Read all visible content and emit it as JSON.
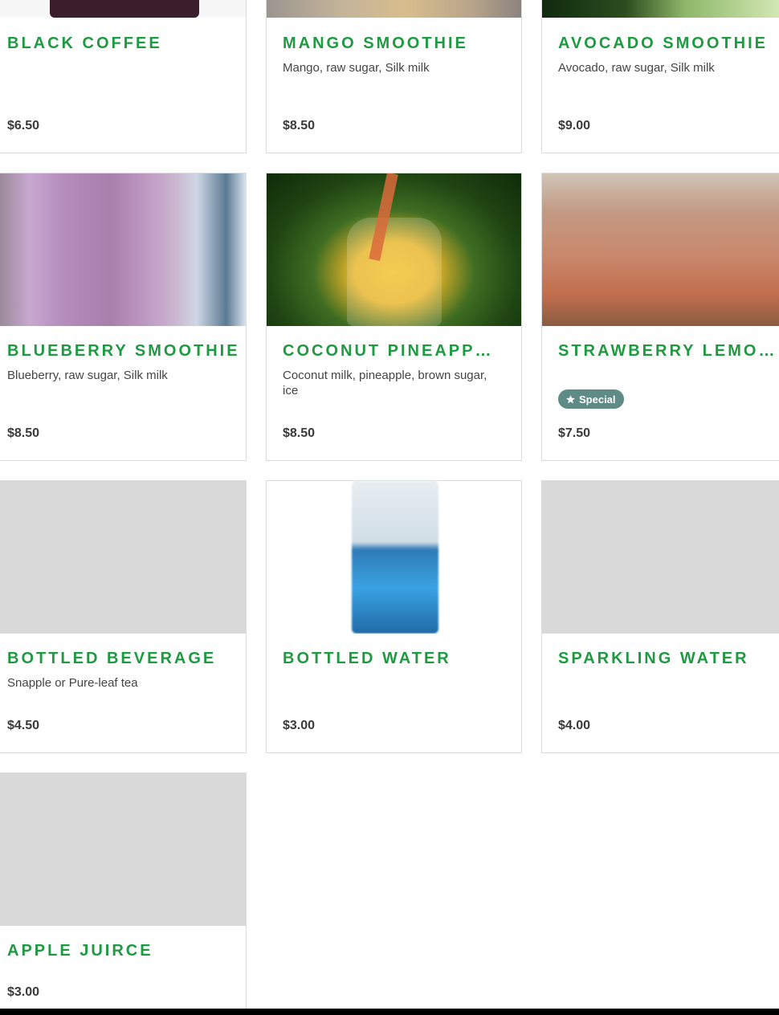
{
  "menu": {
    "items": [
      {
        "name": "Black Coffee",
        "description": "",
        "price": "$6.50",
        "image": "black-coffee-photo"
      },
      {
        "name": "Mango Smoothie",
        "description": "Mango, raw sugar, Silk milk",
        "price": "$8.50",
        "image": "mango-smoothie-photo"
      },
      {
        "name": "Avocado Smoothie",
        "description": "Avocado, raw sugar, Silk milk",
        "price": "$9.00",
        "image": "avocado-smoothie-photo"
      },
      {
        "name": "Blueberry Smoothie",
        "description": "Blueberry, raw sugar, Silk milk",
        "price": "$8.50",
        "image": "blueberry-smoothie-photo"
      },
      {
        "name": "Coconut Pineapple Smoothie",
        "description": "Coconut milk, pineapple, brown sugar, ice",
        "price": "$8.50",
        "image": "coconut-pineapple-photo"
      },
      {
        "name": "Strawberry Lemonade",
        "description": "",
        "price": "$7.50",
        "image": "strawberry-lemonade-photo",
        "badge": "Special",
        "badge_icon": "star-icon"
      },
      {
        "name": "Bottled Beverage",
        "description": "Snapple or Pure-leaf tea",
        "price": "$4.50",
        "image": "placeholder"
      },
      {
        "name": "Bottled Water",
        "description": "",
        "price": "$3.00",
        "image": "bottled-water-photo"
      },
      {
        "name": "Sparkling Water",
        "description": "",
        "price": "$4.00",
        "image": "placeholder"
      },
      {
        "name": "Apple Juirce",
        "description": "",
        "price": "$3.00",
        "image": "placeholder"
      }
    ]
  },
  "colors": {
    "name_green": "#1e9a41",
    "badge_bg": "#5e8b86",
    "placeholder_gray": "#d9d9d9"
  }
}
